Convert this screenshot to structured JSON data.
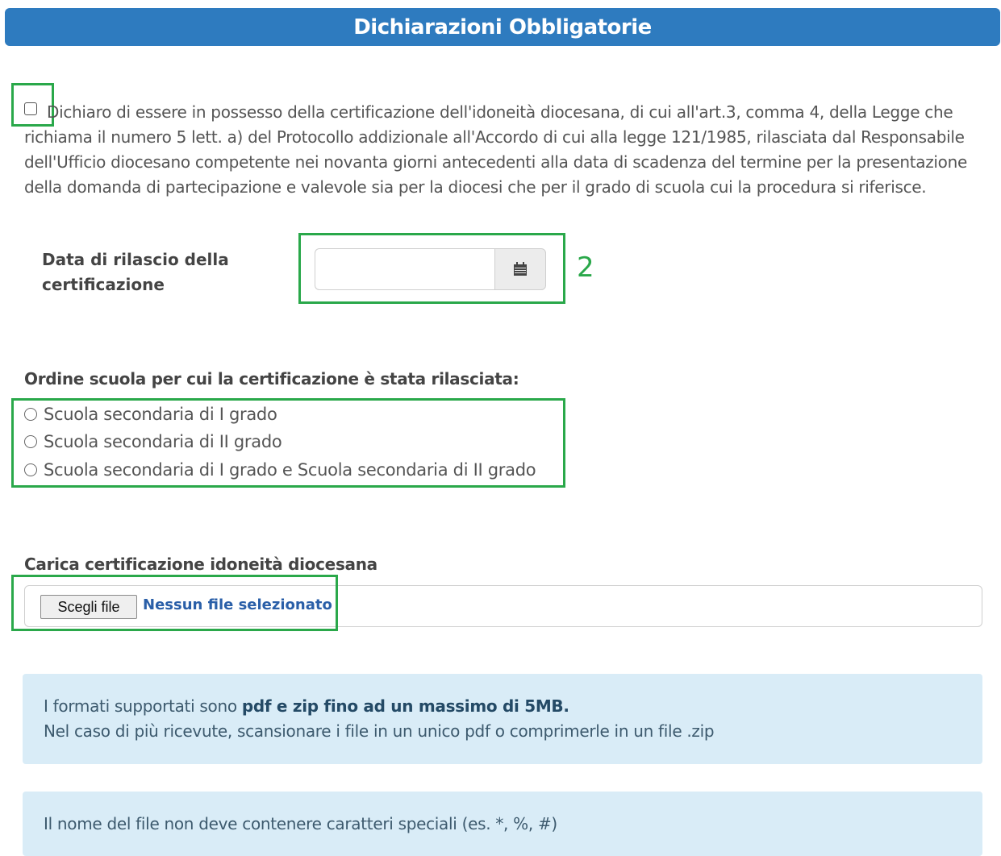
{
  "header": {
    "title": "Dichiarazioni Obbligatorie"
  },
  "declaration": {
    "checked": false,
    "text": "Dichiaro di essere in possesso della certificazione dell'idoneità diocesana, di cui all'art.3, comma 4, della Legge che richiama il numero 5 lett. a) del Protocollo addizionale all'Accordo di cui alla legge 121/1985, rilasciata dal Responsabile dell'Ufficio diocesano competente nei novanta giorni antecedenti alla data di scadenza del termine per la presentazione della domanda di partecipazione e valevole sia per la diocesi che per il grado di scuola cui la procedura si riferisce."
  },
  "release_date": {
    "label": "Data di rilascio della certificazione",
    "value": "",
    "calendar_icon": "calendar-icon"
  },
  "annotation": {
    "marker": "2",
    "color": "#2aa84a"
  },
  "school_order": {
    "label": "Ordine scuola per cui la certificazione è stata rilasciata:",
    "options": [
      "Scuola secondaria di I grado",
      "Scuola secondaria di II grado",
      "Scuola secondaria di I grado e Scuola secondaria di II grado"
    ]
  },
  "upload": {
    "label": "Carica certificazione idoneità diocesana",
    "button": "Scegli file",
    "status": "Nessun file selezionato"
  },
  "info1": {
    "prefix": "I formati supportati sono ",
    "bold": "pdf e zip fino ad un massimo di 5MB.",
    "line2": "Nel caso di più ricevute, scansionare i file in un unico pdf o comprimerle in un file .zip"
  },
  "info2": {
    "text": "Il nome del file non deve contenere caratteri speciali (es. *, %, #)"
  },
  "colors": {
    "header": "#2e7bbf",
    "highlight": "#2aa84a",
    "info_bg": "#d9ecf7"
  }
}
